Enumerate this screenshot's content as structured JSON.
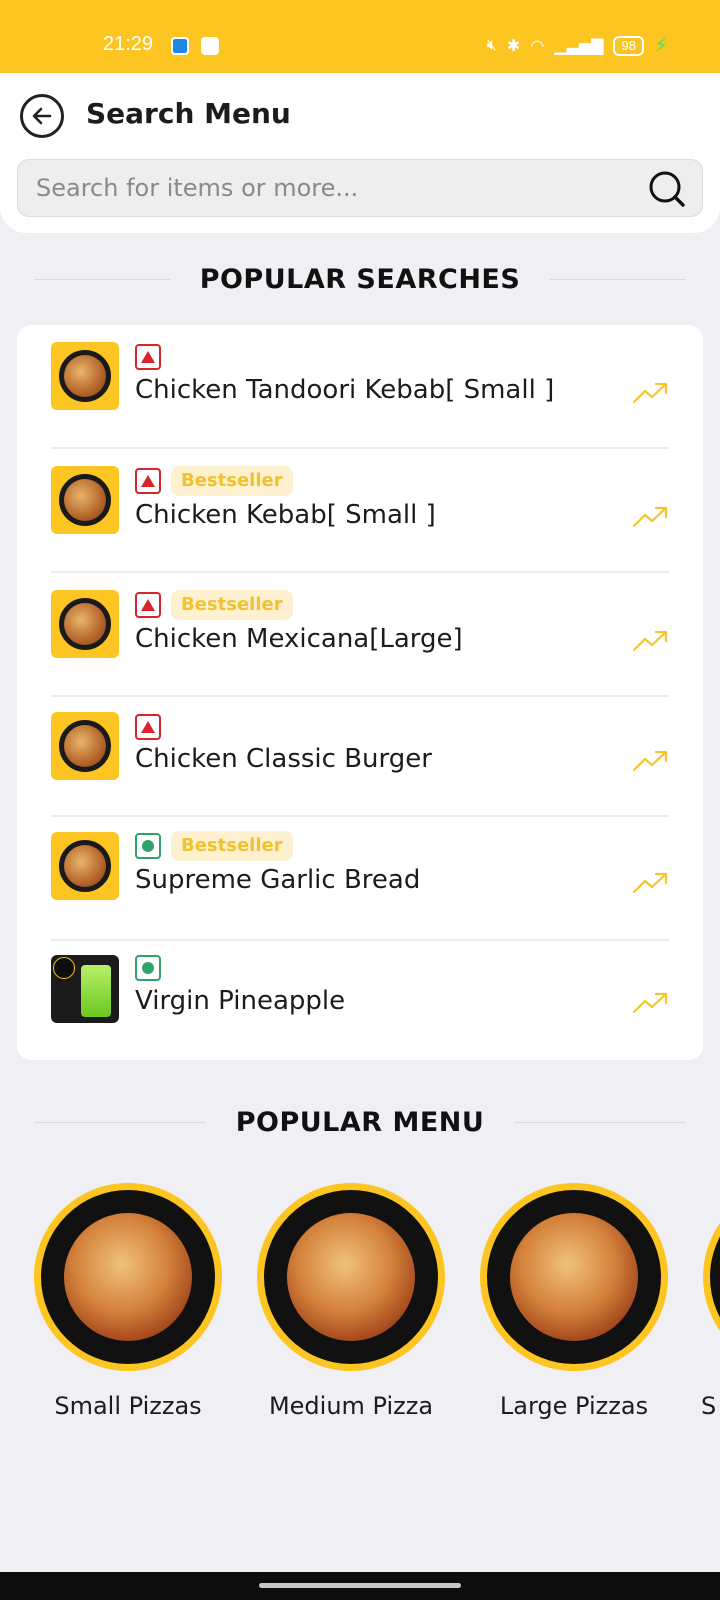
{
  "status_bar": {
    "time": "21:29",
    "battery": "98"
  },
  "header": {
    "title": "Search Menu",
    "back_icon": "back-arrow-icon"
  },
  "search": {
    "placeholder": "Search for items or more...",
    "icon": "search-icon"
  },
  "popular_searches": {
    "heading": "POPULAR SEARCHES",
    "items": [
      {
        "name": "Chicken Tandoori Kebab[ Small ]",
        "type": "nonveg",
        "badge": ""
      },
      {
        "name": "Chicken Kebab[ Small ]",
        "type": "nonveg",
        "badge": "Bestseller"
      },
      {
        "name": "Chicken Mexicana[Large]",
        "type": "nonveg",
        "badge": "Bestseller"
      },
      {
        "name": "Chicken Classic Burger",
        "type": "nonveg",
        "badge": ""
      },
      {
        "name": "Supreme Garlic Bread",
        "type": "veg",
        "badge": "Bestseller"
      },
      {
        "name": "Virgin Pineapple",
        "type": "veg",
        "badge": ""
      }
    ]
  },
  "popular_menu": {
    "heading": "POPULAR MENU",
    "items": [
      {
        "label": "Small Pizzas"
      },
      {
        "label": "Medium Pizza"
      },
      {
        "label": "Large Pizzas"
      },
      {
        "label": "S"
      }
    ]
  },
  "colors": {
    "accent": "#fcc521",
    "nonveg": "#d7262b",
    "veg": "#2fa36b",
    "background": "#efeff4"
  }
}
